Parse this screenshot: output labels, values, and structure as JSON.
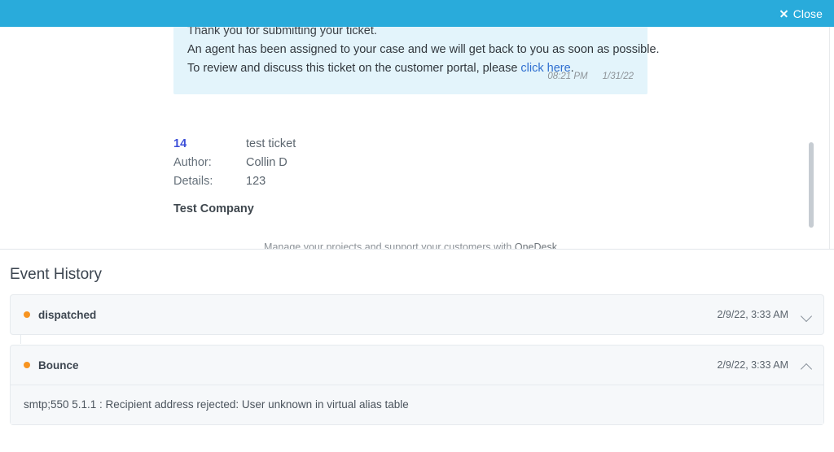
{
  "topbar": {
    "close_label": "Close",
    "close_icon": "close-x-icon",
    "background_color": "#29abdb"
  },
  "email_preview": {
    "bubble_background": "#e3f4fb",
    "lines": [
      "Thank you for submitting your ticket.",
      "An agent has been assigned to your case and we will get back to you as soon as possible."
    ],
    "link_line_prefix": "To review and discuss this ticket on the customer portal, please ",
    "link_text": "click here",
    "link_suffix": ".",
    "link_color": "#2f6fd0",
    "time": "08:21 PM",
    "date": "1/31/22"
  },
  "ticket": {
    "id": "14",
    "id_color": "#3b4ed8",
    "title": "test ticket",
    "author_label": "Author:",
    "author_value": "Collin D",
    "details_label": "Details:",
    "details_value": "123",
    "company": "Test Company",
    "footer_text": "Manage your projects and support your customers with ",
    "footer_link": "OneDesk"
  },
  "scrollbar": {
    "thumb_color": "#c6ccd2",
    "name": "preview-scrollbar"
  },
  "event_history": {
    "title": "Event History",
    "dot_color": "#f79421",
    "events": [
      {
        "name": "dispatched",
        "timestamp": "2/9/22, 3:33 AM",
        "expanded": false,
        "chevron": "chevron-down-icon",
        "body": ""
      },
      {
        "name": "Bounce",
        "timestamp": "2/9/22, 3:33 AM",
        "expanded": true,
        "chevron": "chevron-up-icon",
        "body": "smtp;550 5.1.1 : Recipient address rejected: User unknown in virtual alias table"
      }
    ]
  }
}
